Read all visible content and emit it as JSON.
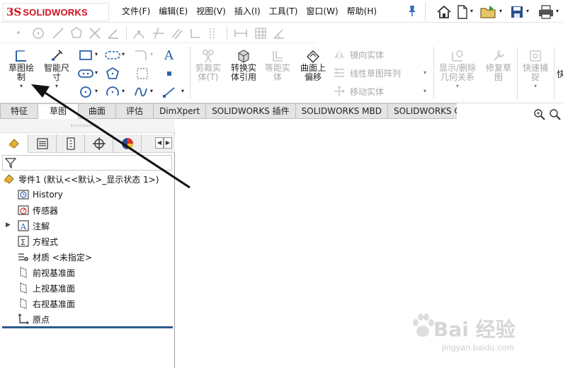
{
  "app": {
    "logo_ds": "3S",
    "logo_brand": "SOLIDWORKS"
  },
  "menu": [
    "文件(F)",
    "编辑(E)",
    "视图(V)",
    "插入(I)",
    "工具(T)",
    "窗口(W)",
    "帮助(H)"
  ],
  "commands": {
    "sketch": "草图绘\n制",
    "smart_dim": "智能尺\n寸",
    "trim": "剪裁实\n体(T)",
    "convert": "转换实\n体引用",
    "offset": "等距实\n体",
    "surface_offset": "曲面上\n偏移",
    "mirror": "镜向实体",
    "linear_pattern": "线性草图阵列",
    "move": "移动实体",
    "display_delete": "显示/删除\n几何关系",
    "repair": "修复草\n图",
    "quick_snap": "快速捕\n捉",
    "more": "快"
  },
  "tabs": [
    "特征",
    "草图",
    "曲面",
    "评估",
    "DimXpert",
    "SOLIDWORKS 插件",
    "SOLIDWORKS MBD",
    "SOLIDWORKS CAM"
  ],
  "active_tab": "草图",
  "tree": {
    "root": "零件1 (默认<<默认>_显示状态 1>)",
    "items": [
      "History",
      "传感器",
      "注解",
      "方程式",
      "材质 <未指定>",
      "前视基准面",
      "上视基准面",
      "右视基准面",
      "原点"
    ]
  },
  "watermark": {
    "main": "Bai 经验",
    "sub": "jingyan.baidu.com"
  },
  "colors": {
    "brand_red": "#d10f1a",
    "accent_blue": "#2f5a8a"
  }
}
